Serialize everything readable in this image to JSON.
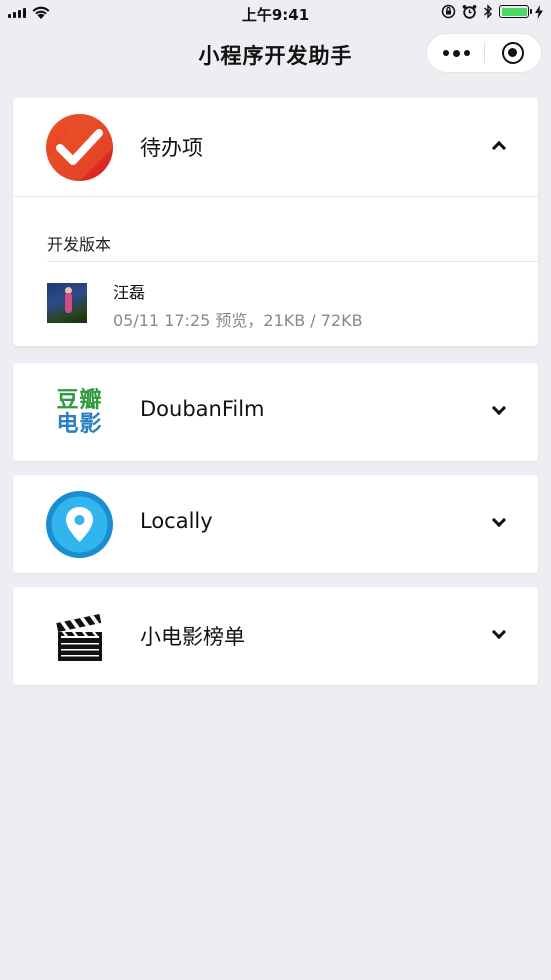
{
  "status_bar": {
    "time": "上午9:41",
    "battery_color": "#4cd964"
  },
  "nav": {
    "title": "小程序开发助手"
  },
  "apps": [
    {
      "name": "待办项",
      "icon": "todo-check-icon",
      "expanded": true,
      "section_title": "开发版本",
      "version": {
        "author": "汪磊",
        "meta": "05/11 17:25 预览，21KB / 72KB"
      }
    },
    {
      "name": "DoubanFilm",
      "icon": "douban-film-icon",
      "icon_text": "豆瓣电影",
      "expanded": false
    },
    {
      "name": "Locally",
      "icon": "location-pin-icon",
      "expanded": false
    },
    {
      "name": "小电影榜单",
      "icon": "clapperboard-icon",
      "expanded": false
    }
  ],
  "colors": {
    "background": "#ededf2",
    "todo_red": "#e8321e",
    "douban_green": "#2e9a3e",
    "douban_blue": "#2a7fc0",
    "locally_blue": "#1ea4e0"
  }
}
